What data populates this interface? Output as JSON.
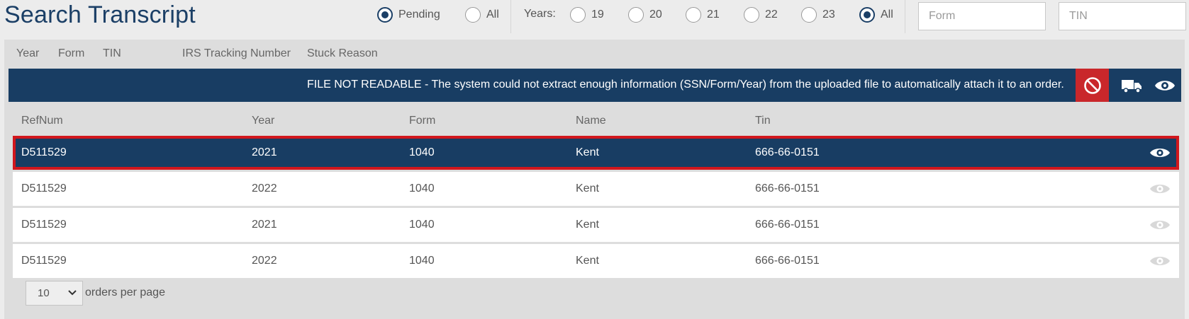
{
  "header": {
    "title": "Search Transcript",
    "status_filter": [
      {
        "label": "Pending",
        "checked": true
      },
      {
        "label": "All",
        "checked": false
      }
    ],
    "years_label": "Years:",
    "year_options": [
      {
        "label": "19",
        "checked": false
      },
      {
        "label": "20",
        "checked": false
      },
      {
        "label": "21",
        "checked": false
      },
      {
        "label": "22",
        "checked": false
      },
      {
        "label": "23",
        "checked": false
      },
      {
        "label": "All",
        "checked": true
      }
    ],
    "form_input": {
      "placeholder": "Form",
      "value": ""
    },
    "tin_input": {
      "placeholder": "TIN",
      "value": ""
    }
  },
  "filter_headers": [
    "Year",
    "Form",
    "TIN",
    "IRS Tracking Number",
    "Stuck Reason"
  ],
  "banner": {
    "message": "FILE NOT READABLE - The system could not extract enough information (SSN/Form/Year) from the uploaded file to automatically attach it to an order.",
    "actions": [
      "ban-icon",
      "truck-icon",
      "eye-icon"
    ],
    "ban_color": "#c9272b"
  },
  "table": {
    "columns": [
      "RefNum",
      "Year",
      "Form",
      "Name",
      "Tin"
    ],
    "rows": [
      {
        "refnum": "D511529",
        "year": "2021",
        "form": "1040",
        "name": "Kent",
        "tin": "666-66-0151",
        "selected": true
      },
      {
        "refnum": "D511529",
        "year": "2022",
        "form": "1040",
        "name": "Kent",
        "tin": "666-66-0151",
        "selected": false
      },
      {
        "refnum": "D511529",
        "year": "2021",
        "form": "1040",
        "name": "Kent",
        "tin": "666-66-0151",
        "selected": false
      },
      {
        "refnum": "D511529",
        "year": "2022",
        "form": "1040",
        "name": "Kent",
        "tin": "666-66-0151",
        "selected": false
      }
    ]
  },
  "pagination": {
    "per_page": "10",
    "label": "orders per page"
  },
  "colors": {
    "primary": "#183d63",
    "selected_border": "#d1171d",
    "background": "#ececec",
    "panel": "#dddddd"
  }
}
